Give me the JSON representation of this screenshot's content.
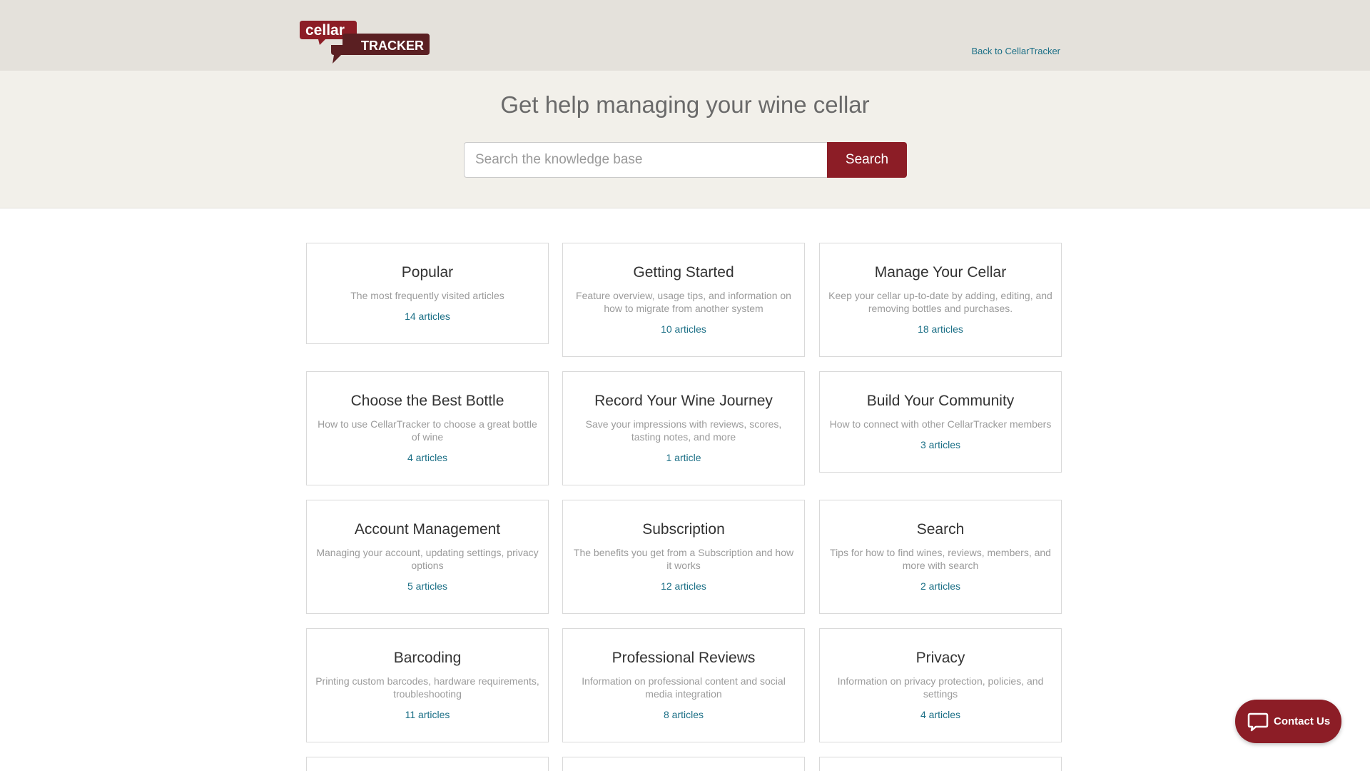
{
  "header": {
    "logo_top": "cellar",
    "logo_bottom": "TRACKER",
    "back_link": "Back to CellarTracker"
  },
  "hero": {
    "title": "Get help managing your wine cellar",
    "search_placeholder": "Search the knowledge base",
    "search_button": "Search"
  },
  "categories": [
    {
      "title": "Popular",
      "description": "The most frequently visited articles",
      "count": "14 articles"
    },
    {
      "title": "Getting Started",
      "description": "Feature overview, usage tips, and information on how to migrate from another system",
      "count": "10 articles"
    },
    {
      "title": "Manage Your Cellar",
      "description": "Keep your cellar up-to-date by adding, editing, and removing bottles and purchases.",
      "count": "18 articles"
    },
    {
      "title": "Choose the Best Bottle",
      "description": "How to use CellarTracker to choose a great bottle of wine",
      "count": "4 articles"
    },
    {
      "title": "Record Your Wine Journey",
      "description": "Save your impressions with reviews, scores, tasting notes, and more",
      "count": "1 article"
    },
    {
      "title": "Build Your Community",
      "description": "How to connect with other CellarTracker members",
      "count": "3 articles"
    },
    {
      "title": "Account Management",
      "description": "Managing your account, updating settings, privacy options",
      "count": "5 articles"
    },
    {
      "title": "Subscription",
      "description": "The benefits you get from a Subscription and how it works",
      "count": "12 articles"
    },
    {
      "title": "Search",
      "description": "Tips for how to find wines, reviews, members, and more with search",
      "count": "2 articles"
    },
    {
      "title": "Barcoding",
      "description": "Printing custom barcodes, hardware requirements, troubleshooting",
      "count": "11 articles"
    },
    {
      "title": "Professional Reviews",
      "description": "Information on professional content and social media integration",
      "count": "8 articles"
    },
    {
      "title": "Privacy",
      "description": "Information on privacy protection, policies, and settings",
      "count": "4 articles"
    }
  ],
  "contact": {
    "label": "Contact Us",
    "icon": "chat-bubble-icon"
  },
  "colors": {
    "brand": "#8c1d26",
    "link": "#1b6f86",
    "header_bg": "#e4e1db",
    "hero_bg": "#f2f0ea"
  }
}
